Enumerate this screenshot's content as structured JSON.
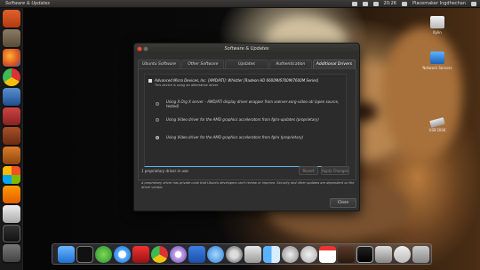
{
  "top_panel": {
    "title": "Software & Updates",
    "clock": "20:26",
    "user": "Placemaker Ingdhechan",
    "indicators": [
      "bluetooth-icon",
      "network-icon",
      "battery-icon",
      "sound-icon",
      "settings-icon"
    ]
  },
  "launcher": {
    "items": [
      "dash-icon",
      "files-icon",
      "firefox-icon",
      "chrome-icon",
      "app-icon",
      "app-icon",
      "app-icon",
      "app-icon",
      "vlc-icon",
      "app-icon",
      "app-icon",
      "terminal-icon",
      "workspace-icon"
    ]
  },
  "desktop": {
    "icons": [
      {
        "label": "Kylin",
        "icon": "home-icon"
      },
      {
        "label": "Network Servers",
        "icon": "network-icon"
      },
      {
        "label": "USB DISK",
        "icon": "usb-drive-icon"
      }
    ]
  },
  "dialog": {
    "title": "Software & Updates",
    "tabs": [
      "Ubuntu Software",
      "Other Software",
      "Updates",
      "Authentication",
      "Additional Drivers"
    ],
    "active_tab": "Additional Drivers",
    "device": {
      "name": "Advanced Micro Devices, Inc. [AMD/ATI]: Whistler [Radeon HD 6600M/6700M/7600M Series]",
      "subtitle": "This device is using an alternative driver."
    },
    "options": [
      {
        "label": "Using X.Org X server – AMD/ATI display driver wrapper from xserver-xorg-video-ati (open source, tested)",
        "selected": false
      },
      {
        "label": "Using Video driver for the AMD graphics accelerators from fglrx-updates (proprietary)",
        "selected": false
      },
      {
        "label": "Using Video driver for the AMD graphics accelerators from fglrx (proprietary)",
        "selected": true
      }
    ],
    "status": "1 proprietary driver in use.",
    "revert_label": "Revert",
    "apply_label": "Apply Changes",
    "note": "A proprietary driver has private code that Ubuntu developers can't review or improve. Security and other updates are dependent on the driver vendor.",
    "close_label": "Close"
  },
  "dock": {
    "items": [
      "downloads-icon",
      "terminal-icon",
      "globe-icon",
      "itunes-icon",
      "flag-icon",
      "chrome-icon",
      "app-icon",
      "word-icon",
      "app-store-icon",
      "settings-icon",
      "app-icon",
      "finder-icon",
      "app-icon",
      "sync-icon",
      "calendar-icon",
      "app-icon",
      "monitor-icon",
      "app-icon",
      "trash-icon"
    ]
  }
}
